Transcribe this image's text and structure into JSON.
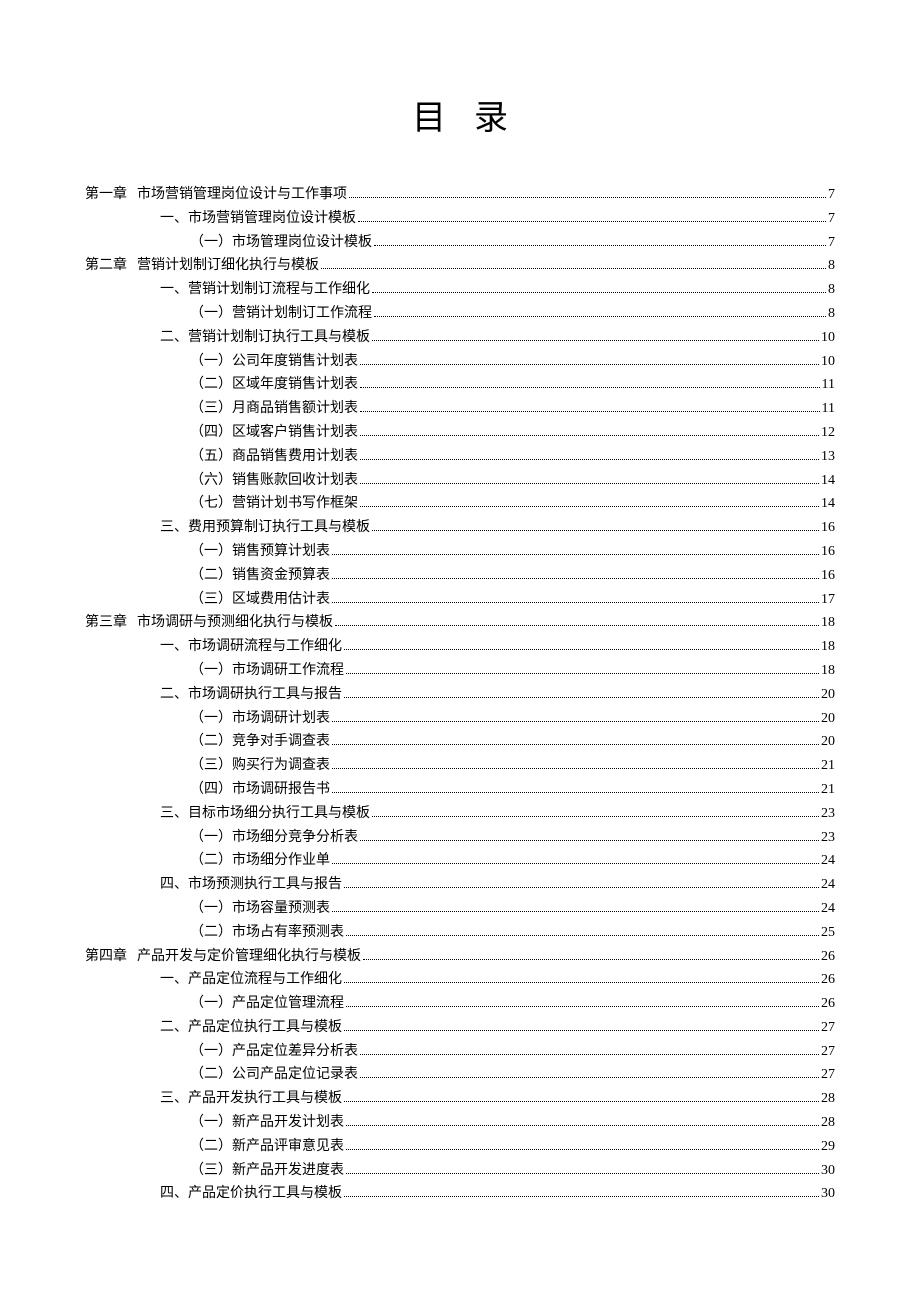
{
  "title": "目录",
  "entries": [
    {
      "level": 0,
      "label": "第一章",
      "text": "市场营销管理岗位设计与工作事项",
      "page": "7"
    },
    {
      "level": 1,
      "text": "一、市场营销管理岗位设计模板",
      "page": "7"
    },
    {
      "level": 2,
      "text": "（一）市场管理岗位设计模板",
      "page": "7"
    },
    {
      "level": 0,
      "label": "第二章",
      "text": "营销计划制订细化执行与模板",
      "page": "8"
    },
    {
      "level": 1,
      "text": "一、营销计划制订流程与工作细化",
      "page": "8"
    },
    {
      "level": 2,
      "text": "（一）营销计划制订工作流程",
      "page": "8"
    },
    {
      "level": 1,
      "text": "二、营销计划制订执行工具与模板",
      "page": "10"
    },
    {
      "level": 2,
      "text": "（一）公司年度销售计划表",
      "page": "10"
    },
    {
      "level": 2,
      "text": "（二）区域年度销售计划表",
      "page": "11"
    },
    {
      "level": 2,
      "text": "（三）月商品销售额计划表",
      "page": "11"
    },
    {
      "level": 2,
      "text": "（四）区域客户销售计划表",
      "page": "12"
    },
    {
      "level": 2,
      "text": "（五）商品销售费用计划表",
      "page": "13"
    },
    {
      "level": 2,
      "text": "（六）销售账款回收计划表",
      "page": "14"
    },
    {
      "level": 2,
      "text": "（七）营销计划书写作框架",
      "page": "14"
    },
    {
      "level": 1,
      "text": "三、费用预算制订执行工具与模板",
      "page": "16"
    },
    {
      "level": 2,
      "text": "（一）销售预算计划表",
      "page": "16"
    },
    {
      "level": 2,
      "text": "（二）销售资金预算表",
      "page": "16"
    },
    {
      "level": 2,
      "text": "（三）区域费用估计表",
      "page": "17"
    },
    {
      "level": 0,
      "label": "第三章",
      "text": "市场调研与预测细化执行与模板",
      "page": "18"
    },
    {
      "level": 1,
      "text": "一、市场调研流程与工作细化",
      "page": "18"
    },
    {
      "level": 2,
      "text": "（一）市场调研工作流程",
      "page": "18"
    },
    {
      "level": 1,
      "text": "二、市场调研执行工具与报告",
      "page": "20"
    },
    {
      "level": 2,
      "text": "（一）市场调研计划表",
      "page": "20"
    },
    {
      "level": 2,
      "text": "（二）竞争对手调查表",
      "page": "20"
    },
    {
      "level": 2,
      "text": "（三）购买行为调查表",
      "page": "21"
    },
    {
      "level": 2,
      "text": "（四）市场调研报告书",
      "page": "21"
    },
    {
      "level": 1,
      "text": "三、目标市场细分执行工具与模板",
      "page": "23"
    },
    {
      "level": 2,
      "text": "（一）市场细分竞争分析表",
      "page": "23"
    },
    {
      "level": 2,
      "text": "（二）市场细分作业单",
      "page": "24"
    },
    {
      "level": 1,
      "text": "四、市场预测执行工具与报告",
      "page": "24"
    },
    {
      "level": 2,
      "text": "（一）市场容量预测表",
      "page": "24"
    },
    {
      "level": 2,
      "text": "（二）市场占有率预测表",
      "page": "25"
    },
    {
      "level": 0,
      "label": "第四章",
      "text": "产品开发与定价管理细化执行与模板",
      "page": "26"
    },
    {
      "level": 1,
      "text": "一、产品定位流程与工作细化",
      "page": "26"
    },
    {
      "level": 2,
      "text": "（一）产品定位管理流程",
      "page": "26"
    },
    {
      "level": 1,
      "text": "二、产品定位执行工具与模板",
      "page": "27"
    },
    {
      "level": 2,
      "text": "（一）产品定位差异分析表",
      "page": "27"
    },
    {
      "level": 2,
      "text": "（二）公司产品定位记录表",
      "page": "27"
    },
    {
      "level": 1,
      "text": "三、产品开发执行工具与模板",
      "page": "28"
    },
    {
      "level": 2,
      "text": "（一）新产品开发计划表",
      "page": "28"
    },
    {
      "level": 2,
      "text": "（二）新产品评审意见表",
      "page": "29"
    },
    {
      "level": 2,
      "text": "（三）新产品开发进度表",
      "page": "30"
    },
    {
      "level": 1,
      "text": "四、产品定价执行工具与模板",
      "page": "30"
    }
  ]
}
